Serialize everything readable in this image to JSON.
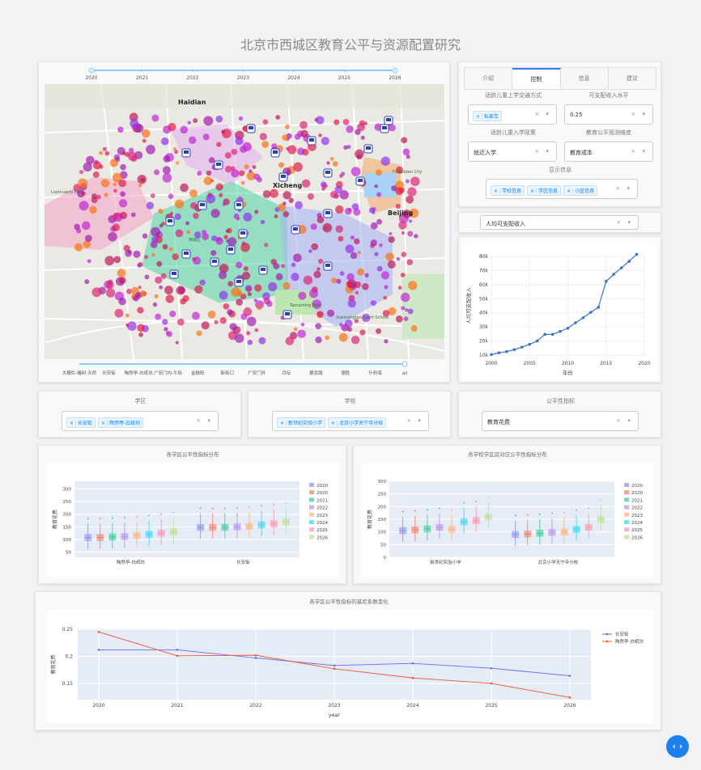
{
  "header": {
    "title": "北京市西城区教育公平与资源配置研究"
  },
  "timeline": {
    "years": [
      "2020",
      "2021",
      "2022",
      "2023",
      "2024",
      "2025",
      "2026"
    ]
  },
  "map": {
    "labels": [
      {
        "t": "Haidian"
      },
      {
        "t": "Xicheng"
      },
      {
        "t": "Beijing"
      },
      {
        "t": "Forbidden City"
      },
      {
        "t": "Lianhuachi Park"
      },
      {
        "t": "Taoranting Park"
      },
      {
        "t": "Xiannongtan Sport School"
      },
      {
        "t": "西城区"
      }
    ],
    "district_slider": [
      "大栅栏-椿树-天桥",
      "长安街",
      "陶然亭-白纸坊",
      "广安门内-牛街",
      "金融街",
      "新街口",
      "广安门外",
      "月坛",
      "展览路",
      "德胜",
      "什刹海",
      "all"
    ]
  },
  "controls": {
    "tabs": [
      "介绍",
      "控制",
      "信息",
      "建议"
    ],
    "active_tab": "控制",
    "transport_label": "适龄儿童上学交通方式",
    "transport_tags": [
      "私家车"
    ],
    "income_label": "可支配收入水平",
    "income_value": "0.25",
    "policy_label": "适龄儿童入学政策",
    "policy_value": "就近入学",
    "dimension_label": "教育公平观测维度",
    "dimension_value": "教育成本",
    "display_label": "显示信息",
    "display_tags": [
      "学校信息",
      "学区信息",
      "小区信息"
    ]
  },
  "income_select": {
    "value": "人均可支配收入"
  },
  "filters": {
    "district_label": "学区",
    "district_tags": [
      "长安街",
      "陶然亭-白纸坊"
    ],
    "school_label": "学校",
    "school_tags": [
      "新世纪实验小学",
      "北京小学天宁寺分校"
    ],
    "metric_label": "公平性指标",
    "metric_value": "教育花费"
  },
  "box1": {
    "title": "各学区公平性指标分布",
    "ylabel": "教育花费",
    "groups": [
      "陶然亭-白纸坊",
      "长安街"
    ],
    "yticks": [
      "50",
      "100",
      "150",
      "200",
      "250",
      "300"
    ]
  },
  "box2": {
    "title": "各学校学区房对应公平性指标分布",
    "ylabel": "教育花费",
    "groups": [
      "新世纪实验小学",
      "北京小学天宁寺分校"
    ],
    "yticks": [
      "0",
      "50",
      "100",
      "150",
      "200",
      "250",
      "300"
    ]
  },
  "legend_years": [
    "2020",
    "2020",
    "2021",
    "2022",
    "2023",
    "2024",
    "2025",
    "2026"
  ],
  "chart_data": [
    {
      "type": "line",
      "title": "",
      "xlabel": "年份",
      "ylabel": "人均可支配收入",
      "xlim": [
        2000,
        2020
      ],
      "ylim": [
        10000,
        80000
      ],
      "xticks": [
        "2000",
        "2005",
        "2010",
        "2015",
        "2020"
      ],
      "yticks": [
        "10k",
        "20k",
        "30k",
        "40k",
        "50k",
        "60k",
        "70k",
        "80k"
      ],
      "x": [
        2000,
        2001,
        2002,
        2003,
        2004,
        2005,
        2006,
        2007,
        2008,
        2009,
        2010,
        2011,
        2012,
        2013,
        2014,
        2015,
        2016,
        2017,
        2018,
        2019
      ],
      "values": [
        10350,
        11600,
        12460,
        13880,
        15640,
        17650,
        19980,
        24720,
        24725,
        26740,
        29070,
        32900,
        36470,
        40320,
        43910,
        62300,
        67300,
        71900,
        76500,
        81500
      ]
    },
    {
      "type": "line",
      "title": "各学区公平性指标的基尼系数变化",
      "xlabel": "year",
      "ylabel": "教育花费",
      "ylim": [
        0.12,
        0.25
      ],
      "x": [
        "2020",
        "2021",
        "2022",
        "2023",
        "2024",
        "2025",
        "2026"
      ],
      "yticks": [
        "0.15",
        "0.2",
        "0.25"
      ],
      "series": [
        {
          "name": "长安街",
          "color": "#636efa",
          "values": [
            0.212,
            0.212,
            0.197,
            0.183,
            0.187,
            0.178,
            0.164
          ]
        },
        {
          "name": "陶然亭-白纸坊",
          "color": "#ef553b",
          "values": [
            0.245,
            0.201,
            0.202,
            0.177,
            0.16,
            0.15,
            0.124
          ]
        }
      ]
    }
  ]
}
